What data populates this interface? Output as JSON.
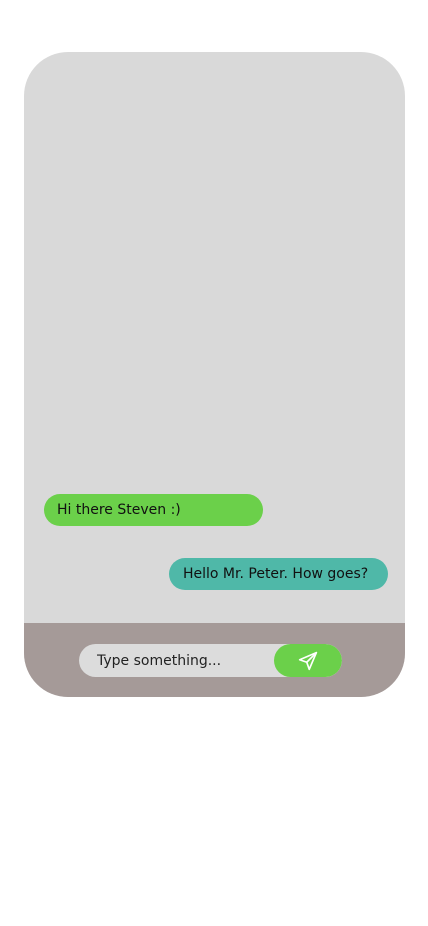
{
  "chat": {
    "messages": [
      {
        "direction": "incoming",
        "text": "Hi there Steven :)"
      },
      {
        "direction": "outgoing",
        "text": "Hello Mr. Peter. How goes?"
      }
    ]
  },
  "composer": {
    "placeholder": "Type something...",
    "value": "",
    "send_icon": "send-icon"
  },
  "colors": {
    "screen_background": "#d9d9d9",
    "incoming_bubble": "#6bd04a",
    "outgoing_bubble": "#4fb8a8",
    "input_bar": "#a59a98",
    "input_field": "#dcdcdc",
    "send_button": "#6bd04a"
  }
}
